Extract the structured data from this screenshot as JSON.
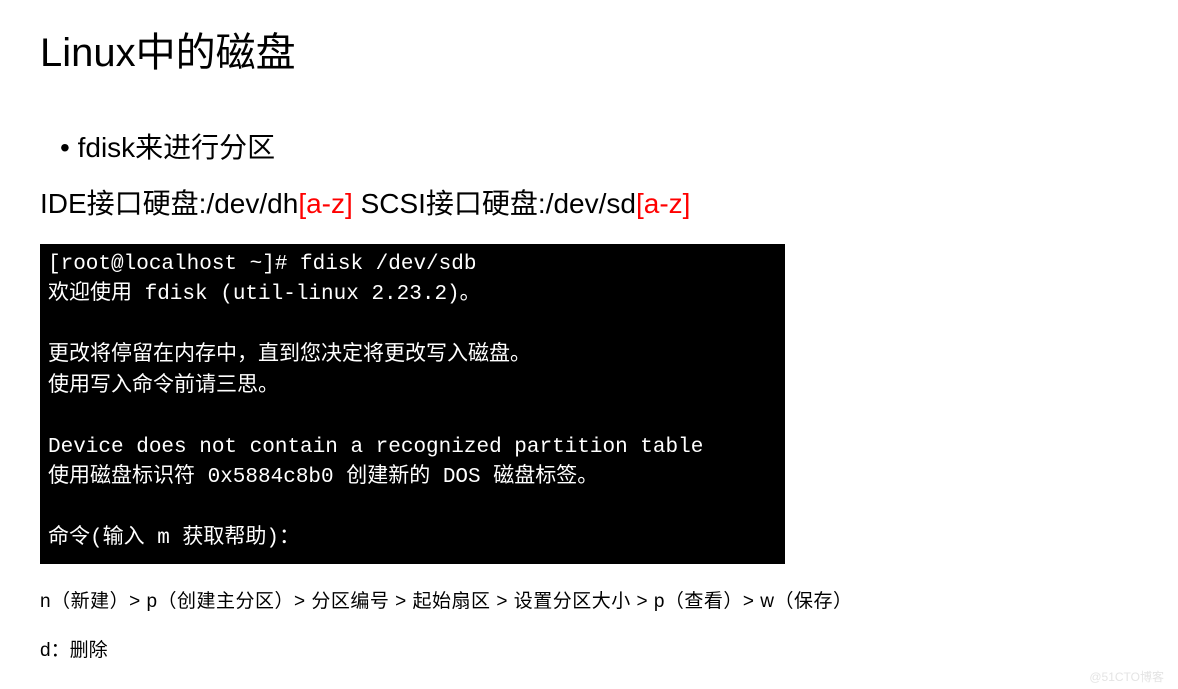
{
  "title": "Linux中的磁盘",
  "bullet": "fdisk来进行分区",
  "line2": {
    "ide_prefix": "IDE接口硬盘:/dev/dh",
    "ide_suffix": "[a-z]",
    "spacer": "  ",
    "scsi_prefix": "SCSI接口硬盘:/dev/sd",
    "scsi_suffix": "[a-z]"
  },
  "terminal": "[root@localhost ~]# fdisk /dev/sdb\n欢迎使用 fdisk (util-linux 2.23.2)。\n\n更改将停留在内存中，直到您决定将更改写入磁盘。\n使用写入命令前请三思。\n\nDevice does not contain a recognized partition table\n使用磁盘标识符 0x5884c8b0 创建新的 DOS 磁盘标签。\n\n命令(输入 m 获取帮助)：",
  "steps": "n（新建）> p（创建主分区）> 分区编号 > 起始扇区 > 设置分区大小 > p（查看）> w（保存）",
  "delete_line": "d：删除",
  "watermark": "@51CTO博客"
}
